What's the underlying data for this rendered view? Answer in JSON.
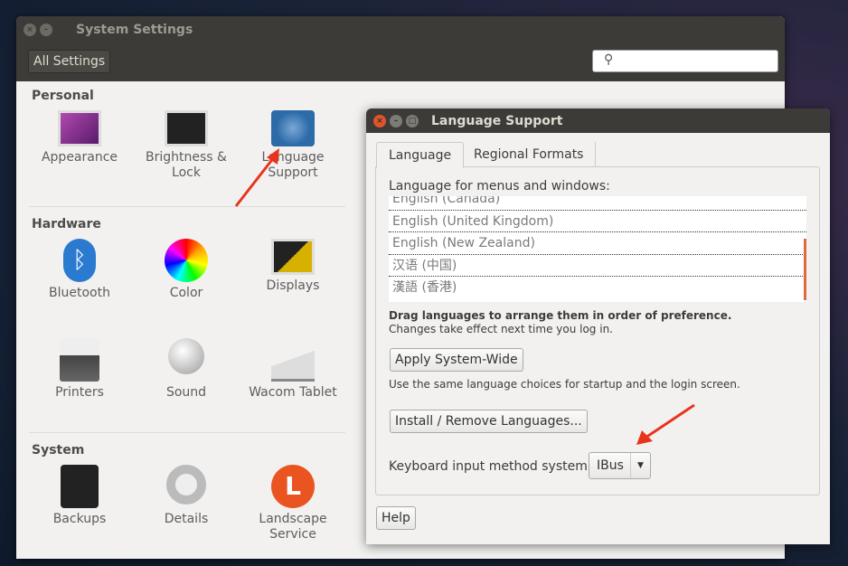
{
  "settings": {
    "title": "System Settings",
    "all_settings": "All Settings",
    "sections": {
      "personal": "Personal",
      "hardware": "Hardware",
      "system": "System"
    },
    "items": {
      "appearance": "Appearance",
      "brightness": "Brightness &",
      "brightness2": "Lock",
      "language": "Language",
      "language2": "Support",
      "bluetooth": "Bluetooth",
      "color": "Color",
      "displays": "Displays",
      "printers": "Printers",
      "sound": "Sound",
      "wacom": "Wacom Tablet",
      "backups": "Backups",
      "details": "Details",
      "landscape": "Landscape",
      "landscape2": "Service"
    }
  },
  "dialog": {
    "title": "Language Support",
    "tabs": [
      "Language",
      "Regional Formats"
    ],
    "list_label": "Language for menus and windows:",
    "languages": [
      "English (Canada)",
      "English (United Kingdom)",
      "English (New Zealand)",
      "汉语 (中国)",
      "漢語 (香港)"
    ],
    "drag_hint": "Drag languages to arrange them in order of preference.",
    "changes_hint": "Changes take effect next time you log in.",
    "apply": "Apply System-Wide",
    "apply_hint": "Use the same language choices for startup and the login screen.",
    "install": "Install / Remove Languages...",
    "keyboard_label": "Keyboard input method system:",
    "keyboard_value": "IBus",
    "help": "Help"
  },
  "colors": {
    "accent": "#e95420",
    "annotation_arrow": "#e8341c"
  }
}
